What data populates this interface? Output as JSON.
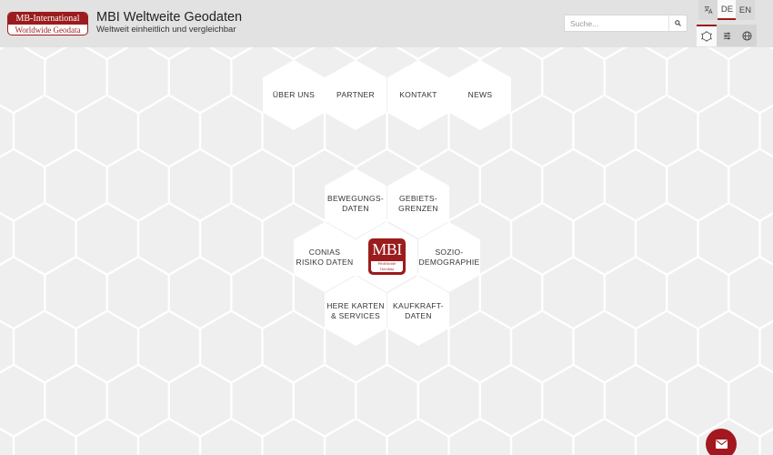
{
  "header": {
    "logo": {
      "top_text": "MB-International",
      "bottom_text": "Worldwide Geodata"
    },
    "title": "MBI Weltweite Geodaten",
    "subtitle": "Weltweit einheitlich und vergleichbar",
    "search": {
      "placeholder": "Suche...",
      "icon": "search-icon"
    },
    "languages": [
      {
        "label": "",
        "icon": "translate-icon",
        "active": false
      },
      {
        "label": "DE",
        "active": true
      },
      {
        "label": "EN",
        "active": false
      }
    ],
    "tools": [
      {
        "icon": "hex-network-icon",
        "active": true
      },
      {
        "icon": "sliders-icon",
        "active": false
      },
      {
        "icon": "globe-icon",
        "active": false
      }
    ]
  },
  "top_nav": [
    {
      "label": "ÜBER UNS"
    },
    {
      "label": "PARTNER"
    },
    {
      "label": "KONTAKT"
    },
    {
      "label": "NEWS"
    }
  ],
  "products": {
    "bewegungsdaten": "BEWEGUNGS-\nDATEN",
    "gebietsgrenzen": "GEBIETS-\nGRENZEN",
    "conias": "CONIAS\nRISIKO DATEN",
    "soziodemographie": "SOZIO-\nDEMOGRAPHIE",
    "here": "HERE KARTEN\n& SERVICES",
    "kaufkraft": "KAUFKRAFT-\nDATEN"
  },
  "center_logo": {
    "big": "MBI",
    "small": "Worldwide\nGeodata"
  },
  "colors": {
    "brand_red": "#9b1c1c",
    "mail_red": "#a3171f",
    "header_bg": "#e2e2e2",
    "page_bg": "#efefef"
  },
  "contact": {
    "icon": "mail-icon"
  }
}
